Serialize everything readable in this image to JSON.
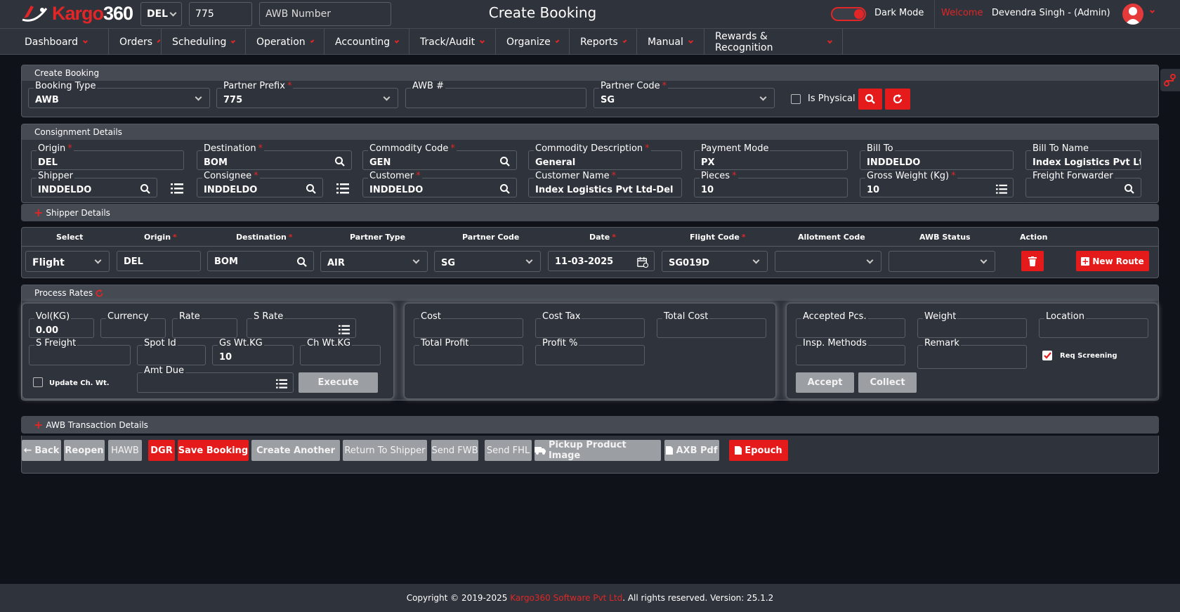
{
  "app": {
    "logo": "Kargo360",
    "station": "DEL",
    "awb_prefix": "775",
    "awb_placeholder": "AWB Number",
    "title": "Create Booking",
    "dark_mode_label": "Dark Mode",
    "welcome": "Welcome",
    "user": "Devendra Singh - (Admin)"
  },
  "menu": [
    "Dashboard",
    "Orders",
    "Scheduling",
    "Operation",
    "Accounting",
    "Track/Audit",
    "Organize",
    "Reports",
    "Manual",
    "Rewards & Recognition"
  ],
  "create_booking": {
    "header": "Create Booking",
    "booking_type_label": "Booking Type",
    "booking_type": "AWB",
    "partner_prefix_label": "Partner Prefix",
    "partner_prefix": "775",
    "awb_label": "AWB #",
    "awb_value": "",
    "partner_code_label": "Partner Code",
    "partner_code": "SG",
    "is_physical_label": "Is Physical"
  },
  "consignment": {
    "header": "Consignment Details",
    "origin_label": "Origin",
    "origin": "DEL",
    "destination_label": "Destination",
    "destination": "BOM",
    "commodity_code_label": "Commodity Code",
    "commodity_code": "GEN",
    "commodity_desc_label": "Commodity Description",
    "commodity_desc": "General",
    "payment_mode_label": "Payment Mode",
    "payment_mode": "PX",
    "bill_to_label": "Bill To",
    "bill_to": "INDDELDO",
    "bill_to_name_label": "Bill To Name",
    "bill_to_name": "Index Logistics  Pvt Ltd",
    "shipper_label": "Shipper",
    "shipper": "INDDELDO",
    "consignee_label": "Consignee",
    "consignee": "INDDELDO",
    "customer_label": "Customer",
    "customer": "INDDELDO",
    "customer_name_label": "Customer Name",
    "customer_name": "Index Logistics  Pvt Ltd-Del",
    "pieces_label": "Pieces",
    "pieces": "10",
    "gross_weight_label": "Gross Weight (Kg)",
    "gross_weight": "10",
    "freight_forwarder_label": "Freight Forwarder",
    "freight_forwarder": ""
  },
  "shipper_details": "Shipper Details",
  "route": {
    "headers": [
      "Select",
      "Origin",
      "Destination",
      "Partner Type",
      "Partner Code",
      "Date",
      "Flight Code",
      "Allotment Code",
      "AWB Status",
      "Action"
    ],
    "select": "Flight",
    "origin": "DEL",
    "destination": "BOM",
    "partner_type": "AIR",
    "partner_code": "SG",
    "date": "11-03-2025",
    "flight_code": "SG019D",
    "allotment_code": "",
    "awb_status": "",
    "new_route": "New Route"
  },
  "rates": {
    "header": "Process Rates",
    "vol_label": "Vol(KG)",
    "vol": "0.00",
    "currency_label": "Currency",
    "rate_label": "Rate",
    "s_rate_label": "S Rate",
    "s_freight_label": "S Freight",
    "spot_id_label": "Spot Id",
    "gs_wt_label": "Gs Wt.KG",
    "gs_wt": "10",
    "ch_wt_label": "Ch Wt.KG",
    "update_ch_wt": "Update Ch. Wt.",
    "amt_due_label": "Amt Due",
    "execute": "Execute",
    "cost_label": "Cost",
    "cost_tax_label": "Cost Tax",
    "total_cost_label": "Total Cost",
    "total_profit_label": "Total Profit",
    "profit_pct_label": "Profit %",
    "accepted_pcs_label": "Accepted Pcs.",
    "weight_label": "Weight",
    "location_label": "Location",
    "insp_methods_label": "Insp. Methods",
    "remark_label": "Remark",
    "req_screening": "Req Screening",
    "accept": "Accept",
    "collect": "Collect"
  },
  "awb_transaction": "AWB Transaction Details",
  "actions": {
    "back": "Back",
    "reopen": "Reopen",
    "hawb": "HAWB",
    "dgr": "DGR",
    "save": "Save Booking",
    "create_another": "Create Another",
    "return_shipper": "Return To Shipper",
    "send_fwb": "Send FWB",
    "send_fhl": "Send FHL",
    "pickup_image": "Pickup Product Image",
    "axb_pdf": "AXB Pdf",
    "epouch": "Epouch"
  },
  "footer": {
    "pre": "Copyright © 2019-2025 ",
    "company": "Kargo360 Software Pvt Ltd",
    "post": ". All rights reserved. Version: 25.1.2"
  },
  "colors": {
    "accent": "#e51b1b",
    "panel": "#2f333b",
    "bg": "#0f1218"
  }
}
